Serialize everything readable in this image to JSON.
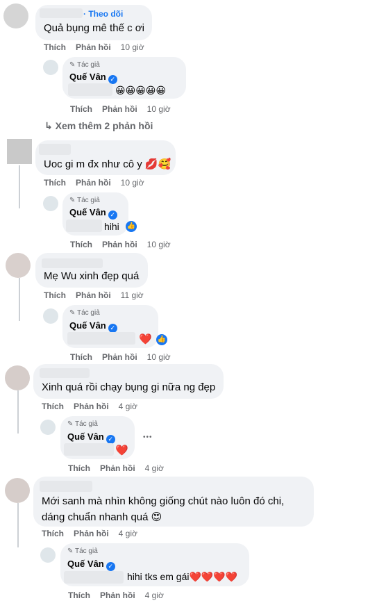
{
  "labels": {
    "like": "Thích",
    "reply": "Phản hồi",
    "author_badge": "Tác giả",
    "follow": "Theo dõi",
    "dot": "·",
    "more_options": "•••"
  },
  "author_name": "Quế Vân",
  "colors": {
    "accent": "#1877f2",
    "heart": "#e41e3f",
    "bubble": "#f0f2f5",
    "meta": "#65676b"
  },
  "c1": {
    "text": "Quả bụng mê thế c ơi",
    "time": "10 giờ",
    "reply": {
      "emojis": "😀😀😀😀😀",
      "time": "10 giờ"
    }
  },
  "view_more": {
    "arrow": "↳",
    "label": "Xem thêm 2 phản hồi"
  },
  "c2": {
    "text": "Uoc gi m đx như cô y 💋🥰",
    "time": "10 giờ",
    "reply": {
      "text": "hihi",
      "time": "10 giờ"
    }
  },
  "c3": {
    "text": "Mẹ Wu xinh đẹp quá",
    "time": "11 giờ",
    "reply": {
      "text": "❤️",
      "time": "10 giờ"
    }
  },
  "c4": {
    "text": "Xinh quá rồi chạy bụng gi nữa ng đẹp",
    "time": "4 giờ",
    "reply": {
      "text": "❤️",
      "time": "4 giờ"
    }
  },
  "c5": {
    "text_line1": "Mới sanh mà nhìn không giống chút nào luôn đó chi,",
    "text_line2": "dáng chuẩn nhanh quá 😍",
    "time": "4 giờ",
    "reply": {
      "text": "hihi tks em gái❤️❤️❤️❤️",
      "time": "4 giờ"
    }
  }
}
